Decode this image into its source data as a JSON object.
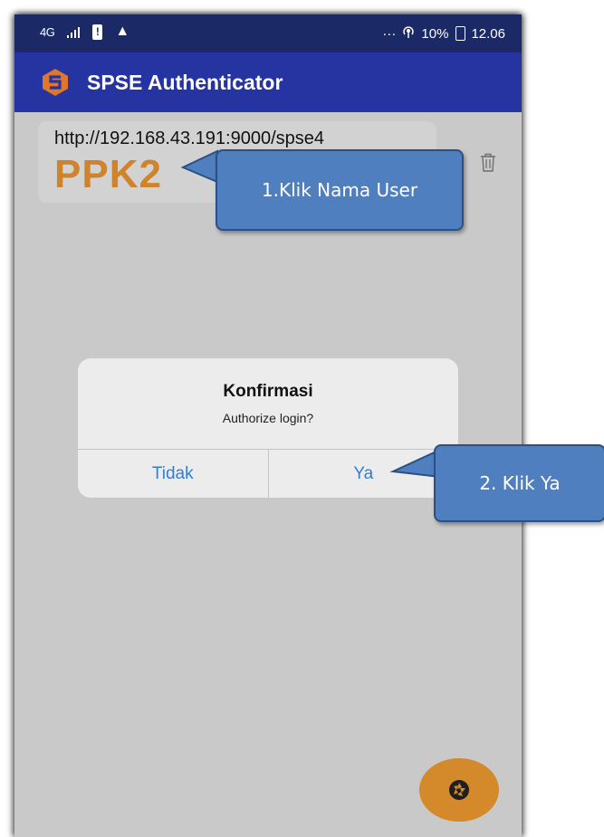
{
  "status_bar": {
    "network": "4G",
    "signal_icon": "signal-bars-icon",
    "battery_alert_icon": "battery-alert-icon",
    "warning_icon": "warning-icon",
    "more_icon": "ellipsis-icon",
    "more_text": "···",
    "hotspot_icon": "hotspot-icon",
    "battery": "10%",
    "time": "12.06"
  },
  "app_bar": {
    "logo_icon": "spse-logo-icon",
    "title": "SPSE Authenticator",
    "color": "#2534a0"
  },
  "account": {
    "url": "http://192.168.43.191:9000/spse4",
    "user": "PPK2",
    "user_color": "#cf842c",
    "delete_icon": "trash-icon"
  },
  "dialog": {
    "title": "Konfirmasi",
    "message": "Authorize login?",
    "cancel_label": "Tidak",
    "confirm_label": "Ya"
  },
  "fab": {
    "icon": "camera-shutter-icon",
    "color": "#d48a2b"
  },
  "callouts": {
    "step1": "1.Klik Nama User",
    "step2": "2. Klik Ya"
  }
}
